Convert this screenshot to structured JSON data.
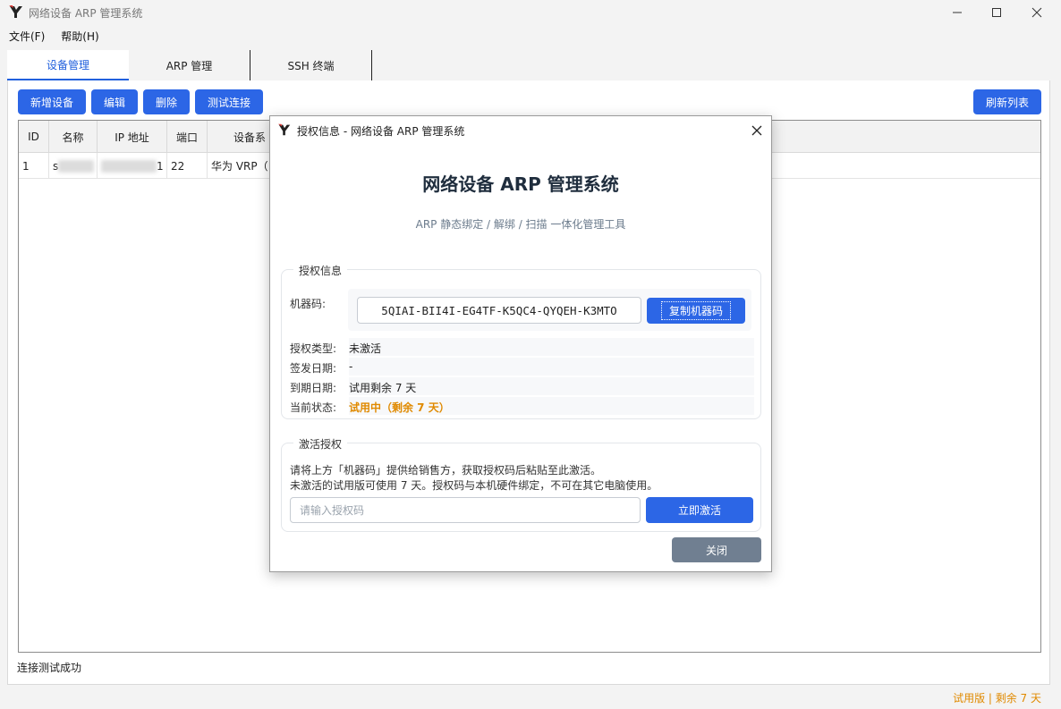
{
  "window": {
    "title": "网络设备 ARP 管理系统"
  },
  "menu": [
    {
      "label": "文件(F)"
    },
    {
      "label": "帮助(H)"
    }
  ],
  "tabs": [
    {
      "label": "设备管理",
      "active": true
    },
    {
      "label": "ARP 管理",
      "active": false
    },
    {
      "label": "SSH 终端",
      "active": false
    }
  ],
  "toolbar": {
    "add_label": "新增设备",
    "edit_label": "编辑",
    "delete_label": "删除",
    "test_label": "测试连接",
    "refresh_label": "刷新列表"
  },
  "table": {
    "columns": [
      "ID",
      "名称",
      "IP 地址",
      "端口",
      "设备系"
    ],
    "rows": [
      {
        "id": "1",
        "name": "s",
        "ip": "1",
        "port": "22",
        "type": "华为 VRP（"
      }
    ]
  },
  "status": {
    "message": "连接测试成功",
    "trial_badge": "试用版 | 剩余 7 天"
  },
  "dialog": {
    "title": "授权信息 - 网络设备 ARP 管理系统",
    "heading": "网络设备 ARP 管理系统",
    "subtitle": "ARP 静态绑定 / 解绑 / 扫描 一体化管理工具",
    "license_group": {
      "legend": "授权信息",
      "machine_code_label": "机器码:",
      "machine_code": "5QIAI-BII4I-EG4TF-K5QC4-QYQEH-K3MTO",
      "copy_label": "复制机器码",
      "rows": [
        {
          "label": "授权类型:",
          "value": "未激活"
        },
        {
          "label": "签发日期:",
          "value": "-"
        },
        {
          "label": "到期日期:",
          "value": "试用剩余 7 天"
        },
        {
          "label": "当前状态:",
          "value": "试用中（剩余 7 天）"
        }
      ]
    },
    "activate_group": {
      "legend": "激活授权",
      "desc_line1": "请将上方「机器码」提供给销售方，获取授权码后粘贴至此激活。",
      "desc_line2": "未激活的试用版可使用 7 天。授权码与本机硬件绑定，不可在其它电脑使用。",
      "input_placeholder": "请输入授权码",
      "activate_label": "立即激活"
    },
    "close_label": "关闭"
  },
  "colors": {
    "accent": "#2c66e6",
    "warning": "#e08a00",
    "close_button": "#707f91"
  }
}
